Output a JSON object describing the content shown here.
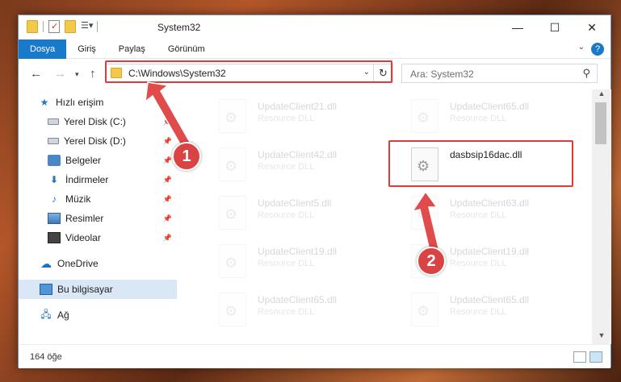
{
  "window": {
    "title": "System32",
    "controls": {
      "minimize": "—",
      "maximize": "☐",
      "close": "✕"
    }
  },
  "ribbon": {
    "tabs": [
      {
        "label": "Dosya",
        "active": true
      },
      {
        "label": "Giriş"
      },
      {
        "label": "Paylaş"
      },
      {
        "label": "Görünüm"
      }
    ],
    "help": "?"
  },
  "address": {
    "path": "C:\\Windows\\System32",
    "search_placeholder": "Ara: System32"
  },
  "sidebar": {
    "items": [
      {
        "label": "Hızlı erişim",
        "icon": "star-icon"
      },
      {
        "label": "Yerel Disk (C:)",
        "icon": "drive-icon",
        "pinned": true
      },
      {
        "label": "Yerel Disk (D:)",
        "icon": "drive-icon",
        "pinned": true
      },
      {
        "label": "Belgeler",
        "icon": "documents-icon",
        "pinned": true
      },
      {
        "label": "İndirmeler",
        "icon": "downloads-icon",
        "pinned": true
      },
      {
        "label": "Müzik",
        "icon": "music-icon",
        "pinned": true
      },
      {
        "label": "Resimler",
        "icon": "pictures-icon",
        "pinned": true
      },
      {
        "label": "Videolar",
        "icon": "videos-icon",
        "pinned": true
      },
      {
        "label": "OneDrive",
        "icon": "cloud-icon"
      },
      {
        "label": "Bu bilgisayar",
        "icon": "computer-icon",
        "selected": true
      },
      {
        "label": "Ağ",
        "icon": "network-icon"
      }
    ]
  },
  "files": [
    {
      "name": "UpdateClient21.dll",
      "type": "Resource DLL",
      "faded": true
    },
    {
      "name": "UpdateClient65.dll",
      "type": "Resource DLL",
      "faded": true
    },
    {
      "name": "UpdateClient42.dll",
      "type": "Resource DLL",
      "faded": true
    },
    {
      "name": "dasbsip16dac.dll",
      "type": "",
      "faded": false
    },
    {
      "name": "UpdateClient5.dll",
      "type": "Resource DLL",
      "faded": true
    },
    {
      "name": "UpdateClient63.dll",
      "type": "Resource DLL",
      "faded": true
    },
    {
      "name": "UpdateClient19.dll",
      "type": "Resource DLL",
      "faded": true
    },
    {
      "name": "UpdateClient19.dll",
      "type": "Resource DLL",
      "faded": true
    },
    {
      "name": "UpdateClient65.dll",
      "type": "Resource DLL",
      "faded": true
    },
    {
      "name": "UpdateClient65.dll",
      "type": "Resource DLL",
      "faded": true
    }
  ],
  "status": {
    "count": "164 öğe"
  },
  "annotations": {
    "badge1": "1",
    "badge2": "2",
    "color": "#d94343"
  }
}
